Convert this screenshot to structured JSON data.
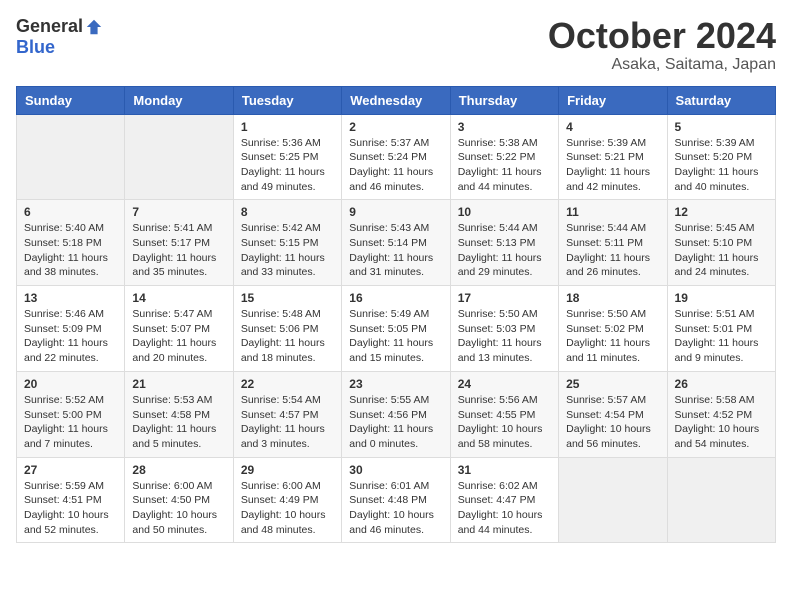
{
  "header": {
    "logo_general": "General",
    "logo_blue": "Blue",
    "month_title": "October 2024",
    "location": "Asaka, Saitama, Japan"
  },
  "calendar": {
    "headers": [
      "Sunday",
      "Monday",
      "Tuesday",
      "Wednesday",
      "Thursday",
      "Friday",
      "Saturday"
    ],
    "rows": [
      [
        {
          "day": "",
          "empty": true
        },
        {
          "day": "",
          "empty": true
        },
        {
          "day": "1",
          "sunrise": "Sunrise: 5:36 AM",
          "sunset": "Sunset: 5:25 PM",
          "daylight": "Daylight: 11 hours and 49 minutes."
        },
        {
          "day": "2",
          "sunrise": "Sunrise: 5:37 AM",
          "sunset": "Sunset: 5:24 PM",
          "daylight": "Daylight: 11 hours and 46 minutes."
        },
        {
          "day": "3",
          "sunrise": "Sunrise: 5:38 AM",
          "sunset": "Sunset: 5:22 PM",
          "daylight": "Daylight: 11 hours and 44 minutes."
        },
        {
          "day": "4",
          "sunrise": "Sunrise: 5:39 AM",
          "sunset": "Sunset: 5:21 PM",
          "daylight": "Daylight: 11 hours and 42 minutes."
        },
        {
          "day": "5",
          "sunrise": "Sunrise: 5:39 AM",
          "sunset": "Sunset: 5:20 PM",
          "daylight": "Daylight: 11 hours and 40 minutes."
        }
      ],
      [
        {
          "day": "6",
          "sunrise": "Sunrise: 5:40 AM",
          "sunset": "Sunset: 5:18 PM",
          "daylight": "Daylight: 11 hours and 38 minutes."
        },
        {
          "day": "7",
          "sunrise": "Sunrise: 5:41 AM",
          "sunset": "Sunset: 5:17 PM",
          "daylight": "Daylight: 11 hours and 35 minutes."
        },
        {
          "day": "8",
          "sunrise": "Sunrise: 5:42 AM",
          "sunset": "Sunset: 5:15 PM",
          "daylight": "Daylight: 11 hours and 33 minutes."
        },
        {
          "day": "9",
          "sunrise": "Sunrise: 5:43 AM",
          "sunset": "Sunset: 5:14 PM",
          "daylight": "Daylight: 11 hours and 31 minutes."
        },
        {
          "day": "10",
          "sunrise": "Sunrise: 5:44 AM",
          "sunset": "Sunset: 5:13 PM",
          "daylight": "Daylight: 11 hours and 29 minutes."
        },
        {
          "day": "11",
          "sunrise": "Sunrise: 5:44 AM",
          "sunset": "Sunset: 5:11 PM",
          "daylight": "Daylight: 11 hours and 26 minutes."
        },
        {
          "day": "12",
          "sunrise": "Sunrise: 5:45 AM",
          "sunset": "Sunset: 5:10 PM",
          "daylight": "Daylight: 11 hours and 24 minutes."
        }
      ],
      [
        {
          "day": "13",
          "sunrise": "Sunrise: 5:46 AM",
          "sunset": "Sunset: 5:09 PM",
          "daylight": "Daylight: 11 hours and 22 minutes."
        },
        {
          "day": "14",
          "sunrise": "Sunrise: 5:47 AM",
          "sunset": "Sunset: 5:07 PM",
          "daylight": "Daylight: 11 hours and 20 minutes."
        },
        {
          "day": "15",
          "sunrise": "Sunrise: 5:48 AM",
          "sunset": "Sunset: 5:06 PM",
          "daylight": "Daylight: 11 hours and 18 minutes."
        },
        {
          "day": "16",
          "sunrise": "Sunrise: 5:49 AM",
          "sunset": "Sunset: 5:05 PM",
          "daylight": "Daylight: 11 hours and 15 minutes."
        },
        {
          "day": "17",
          "sunrise": "Sunrise: 5:50 AM",
          "sunset": "Sunset: 5:03 PM",
          "daylight": "Daylight: 11 hours and 13 minutes."
        },
        {
          "day": "18",
          "sunrise": "Sunrise: 5:50 AM",
          "sunset": "Sunset: 5:02 PM",
          "daylight": "Daylight: 11 hours and 11 minutes."
        },
        {
          "day": "19",
          "sunrise": "Sunrise: 5:51 AM",
          "sunset": "Sunset: 5:01 PM",
          "daylight": "Daylight: 11 hours and 9 minutes."
        }
      ],
      [
        {
          "day": "20",
          "sunrise": "Sunrise: 5:52 AM",
          "sunset": "Sunset: 5:00 PM",
          "daylight": "Daylight: 11 hours and 7 minutes."
        },
        {
          "day": "21",
          "sunrise": "Sunrise: 5:53 AM",
          "sunset": "Sunset: 4:58 PM",
          "daylight": "Daylight: 11 hours and 5 minutes."
        },
        {
          "day": "22",
          "sunrise": "Sunrise: 5:54 AM",
          "sunset": "Sunset: 4:57 PM",
          "daylight": "Daylight: 11 hours and 3 minutes."
        },
        {
          "day": "23",
          "sunrise": "Sunrise: 5:55 AM",
          "sunset": "Sunset: 4:56 PM",
          "daylight": "Daylight: 11 hours and 0 minutes."
        },
        {
          "day": "24",
          "sunrise": "Sunrise: 5:56 AM",
          "sunset": "Sunset: 4:55 PM",
          "daylight": "Daylight: 10 hours and 58 minutes."
        },
        {
          "day": "25",
          "sunrise": "Sunrise: 5:57 AM",
          "sunset": "Sunset: 4:54 PM",
          "daylight": "Daylight: 10 hours and 56 minutes."
        },
        {
          "day": "26",
          "sunrise": "Sunrise: 5:58 AM",
          "sunset": "Sunset: 4:52 PM",
          "daylight": "Daylight: 10 hours and 54 minutes."
        }
      ],
      [
        {
          "day": "27",
          "sunrise": "Sunrise: 5:59 AM",
          "sunset": "Sunset: 4:51 PM",
          "daylight": "Daylight: 10 hours and 52 minutes."
        },
        {
          "day": "28",
          "sunrise": "Sunrise: 6:00 AM",
          "sunset": "Sunset: 4:50 PM",
          "daylight": "Daylight: 10 hours and 50 minutes."
        },
        {
          "day": "29",
          "sunrise": "Sunrise: 6:00 AM",
          "sunset": "Sunset: 4:49 PM",
          "daylight": "Daylight: 10 hours and 48 minutes."
        },
        {
          "day": "30",
          "sunrise": "Sunrise: 6:01 AM",
          "sunset": "Sunset: 4:48 PM",
          "daylight": "Daylight: 10 hours and 46 minutes."
        },
        {
          "day": "31",
          "sunrise": "Sunrise: 6:02 AM",
          "sunset": "Sunset: 4:47 PM",
          "daylight": "Daylight: 10 hours and 44 minutes."
        },
        {
          "day": "",
          "empty": true
        },
        {
          "day": "",
          "empty": true
        }
      ]
    ]
  }
}
